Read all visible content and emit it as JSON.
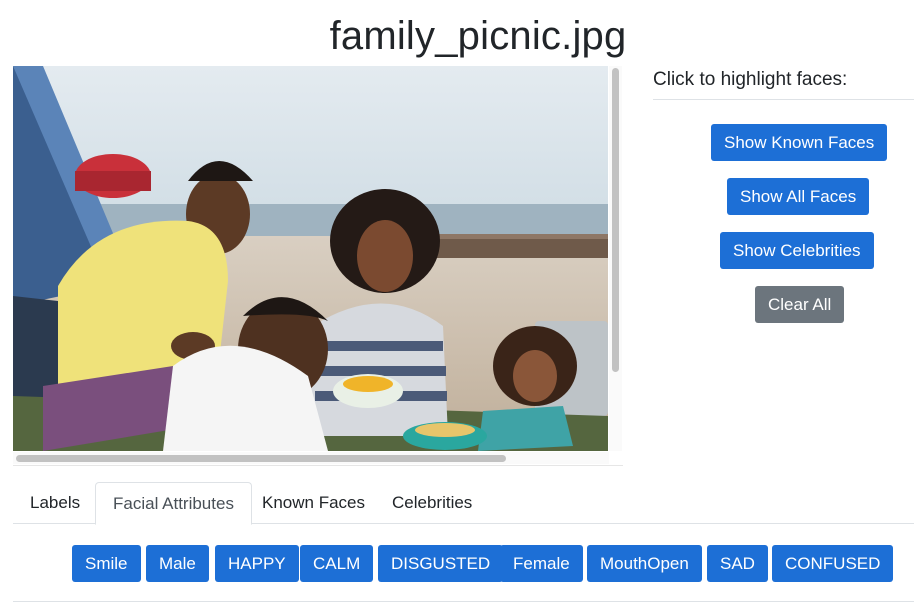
{
  "title": "family_picnic.jpg",
  "image": {
    "alt": "family_picnic.jpg"
  },
  "panel": {
    "heading": "Click to highlight faces:",
    "buttons": [
      {
        "label": "Show Known Faces",
        "style": "primary"
      },
      {
        "label": "Show All Faces",
        "style": "primary"
      },
      {
        "label": "Show Celebrities",
        "style": "primary"
      },
      {
        "label": "Clear All",
        "style": "secondary"
      }
    ]
  },
  "tabs": [
    {
      "label": "Labels",
      "active": false
    },
    {
      "label": "Facial Attributes",
      "active": true
    },
    {
      "label": "Known Faces",
      "active": false
    },
    {
      "label": "Celebrities",
      "active": false
    }
  ],
  "attribute_tags": [
    "Smile",
    "Male",
    "HAPPY",
    "CALM",
    "DISGUSTED",
    "Female",
    "MouthOpen",
    "SAD",
    "CONFUSED"
  ],
  "colors": {
    "primary": "#1d6fd6",
    "secondary": "#6c757d",
    "border": "#dee2e6"
  }
}
